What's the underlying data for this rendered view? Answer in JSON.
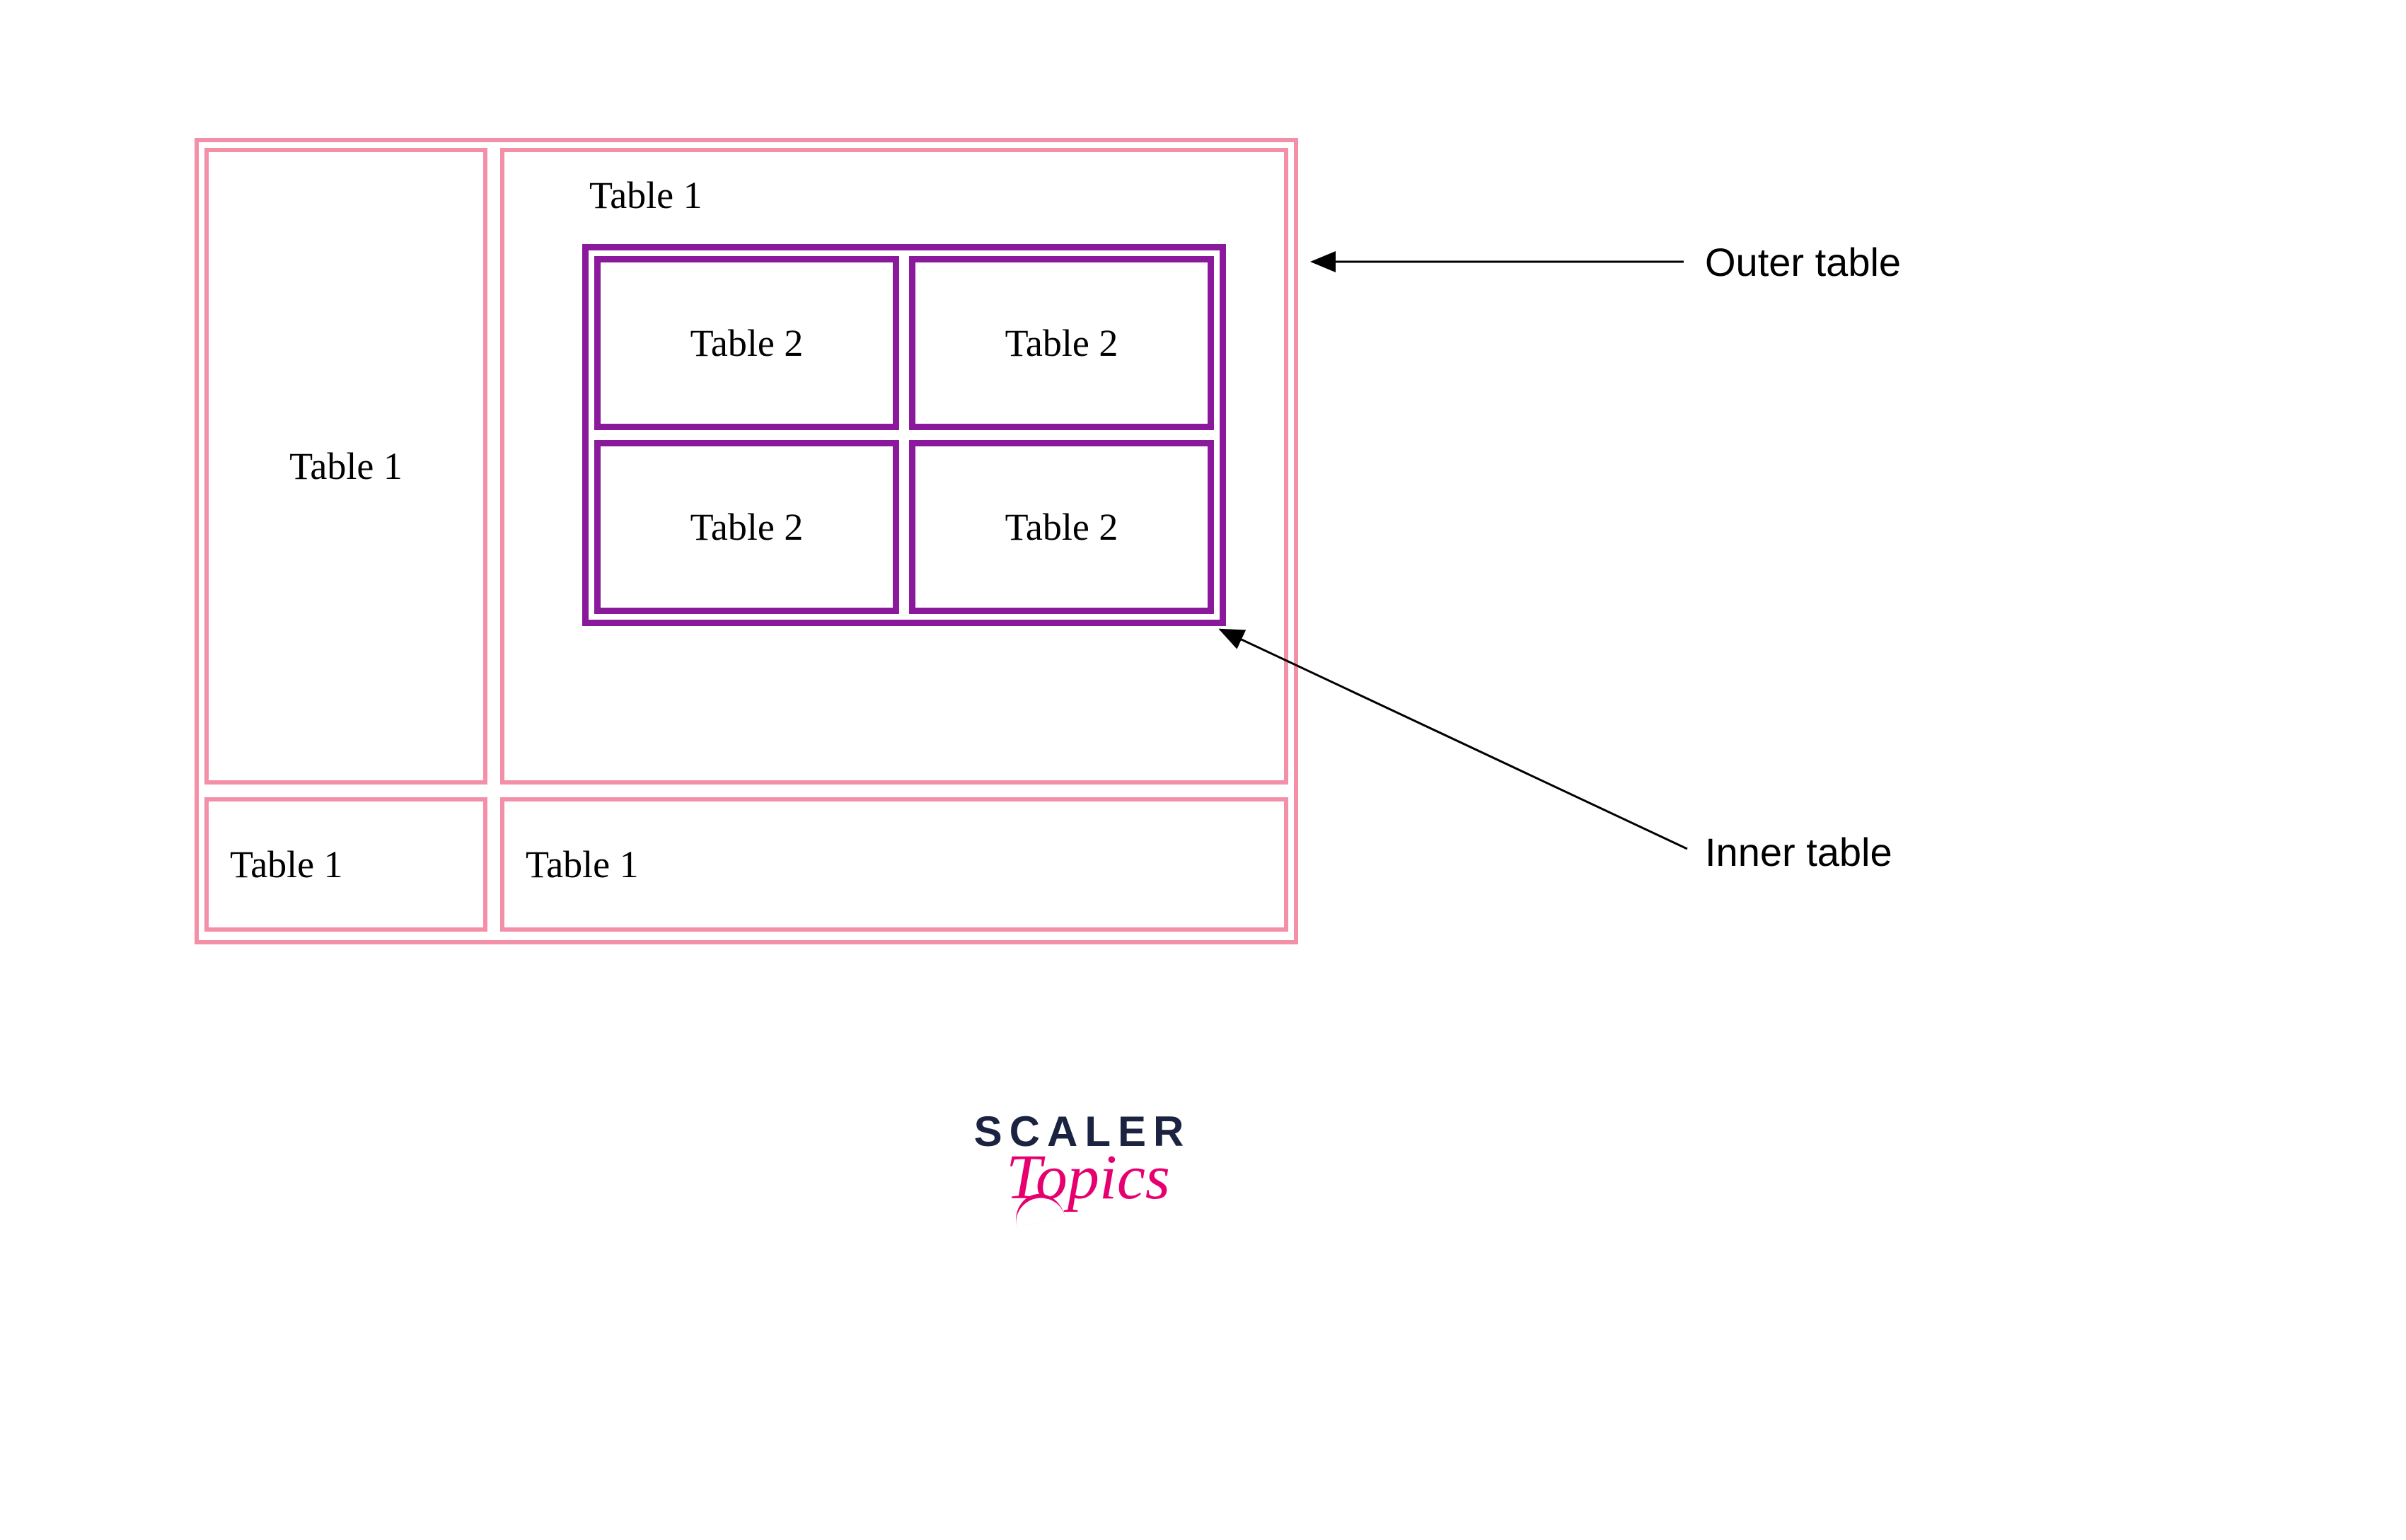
{
  "colors": {
    "outer": "#f48fa8",
    "inner": "#8a1a9b"
  },
  "outer_table": {
    "row1": {
      "left_label": "Table 1",
      "right_heading": "Table 1"
    },
    "row2": {
      "left_label": "Table 1",
      "right_label": "Table 1"
    }
  },
  "inner_table": {
    "cells": [
      "Table 2",
      "Table 2",
      "Table 2",
      "Table 2"
    ]
  },
  "annotations": {
    "outer_label": "Outer table",
    "inner_label": "Inner table"
  },
  "logo": {
    "line1": "SCALER",
    "line2": "Topics"
  }
}
